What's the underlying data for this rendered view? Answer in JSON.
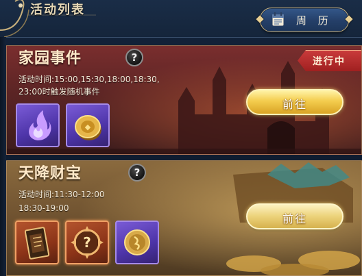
{
  "header": {
    "title": "活动列表",
    "calendar_label": "周 历",
    "icons": [
      "calendar-icon"
    ]
  },
  "events": [
    {
      "title": "家园事件",
      "time_line1": "活动时间:15:00,15:30,18:00,18:30,",
      "time_line2": "23:00时触发随机事件",
      "status": "进行中",
      "go_label": "前往",
      "rewards": [
        {
          "icon": "purple-flame-icon",
          "frame": "purple"
        },
        {
          "icon": "gold-coin-icon",
          "frame": "purple"
        }
      ]
    },
    {
      "title": "天降财宝",
      "time_line1": "活动时间:11:30-12:00",
      "time_line2": "18:30-19:00",
      "go_label": "前往",
      "rewards": [
        {
          "icon": "treasure-scroll-icon",
          "frame": "orange"
        },
        {
          "icon": "mystery-reward-icon",
          "frame": "orange"
        },
        {
          "icon": "gold-medal-icon",
          "frame": "purple"
        }
      ]
    }
  ],
  "colors": {
    "accent_gold": "#f4cd4e",
    "status_red": "#c93b3b",
    "rare_purple": "#4d34a8",
    "epic_orange": "#8c3418"
  }
}
